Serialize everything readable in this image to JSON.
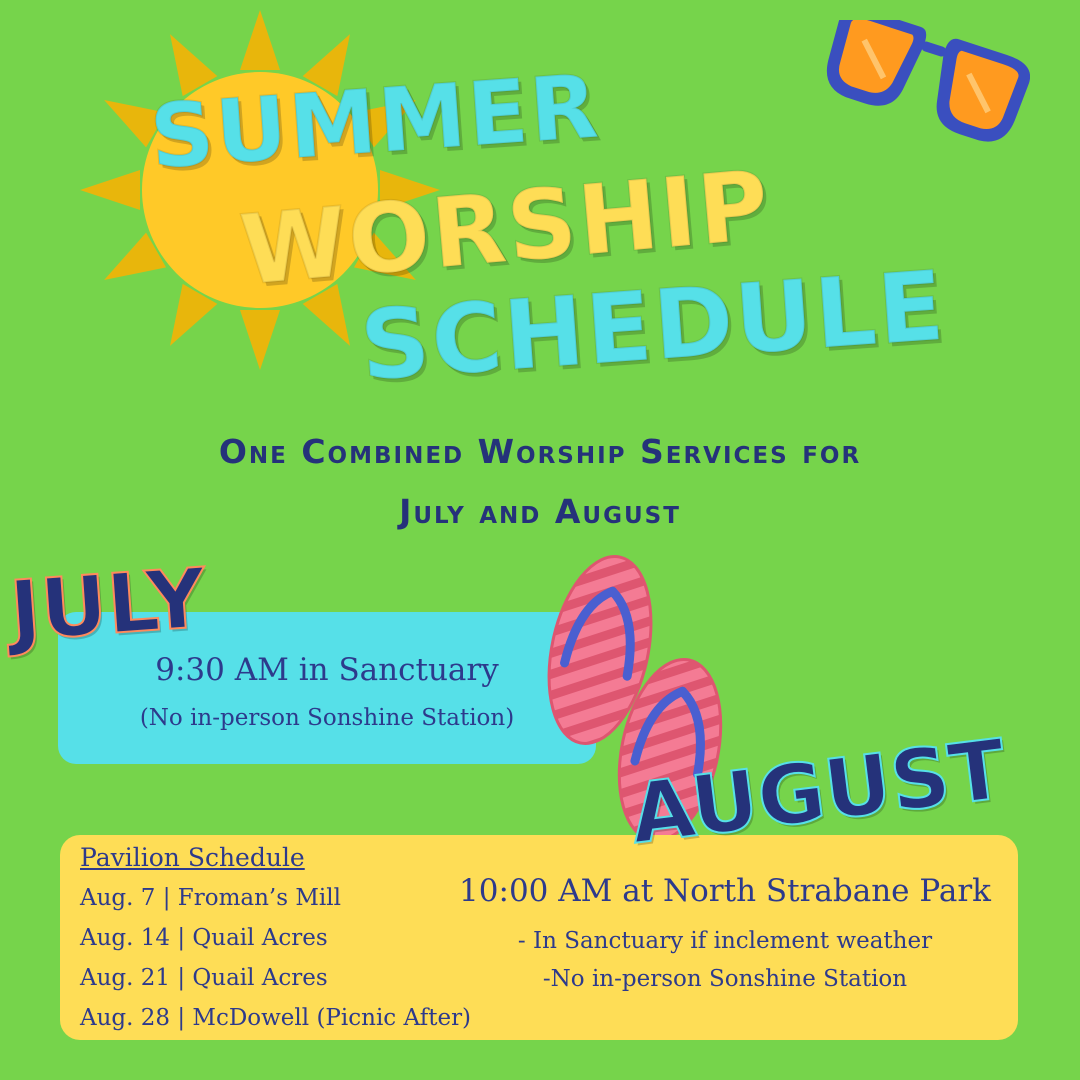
{
  "title": {
    "line1": "Summer",
    "line2": "Worship",
    "line3": "Schedule"
  },
  "subtitle": {
    "line1": "One Combined Worship Services for",
    "line2": "July and August"
  },
  "july": {
    "heading": "July",
    "time": "9:30 AM in Sanctuary",
    "note": "(No in-person Sonshine Station)"
  },
  "august": {
    "heading": "August",
    "pavilion_header": "Pavilion Schedule",
    "pavilion_items": [
      "Aug. 7 | Froman’s Mill",
      "Aug. 14 | Quail Acres",
      "Aug. 21 | Quail Acres",
      "Aug. 28 | McDowell (Picnic After)"
    ],
    "time": "10:00 AM at North Strabane Park",
    "notes": [
      "- In Sanctuary if inclement weather",
      "-No in-person Sonshine Station"
    ]
  },
  "colors": {
    "background": "#76d44b",
    "cyan": "#56e0e8",
    "yellow": "#fedd56",
    "navy": "#25327a",
    "sun": "#ffc928",
    "sun_rays": "#e8b60c",
    "pink": "#f26d86"
  },
  "icons": [
    "sun-icon",
    "sunglasses-icon",
    "flip-flops-icon"
  ]
}
